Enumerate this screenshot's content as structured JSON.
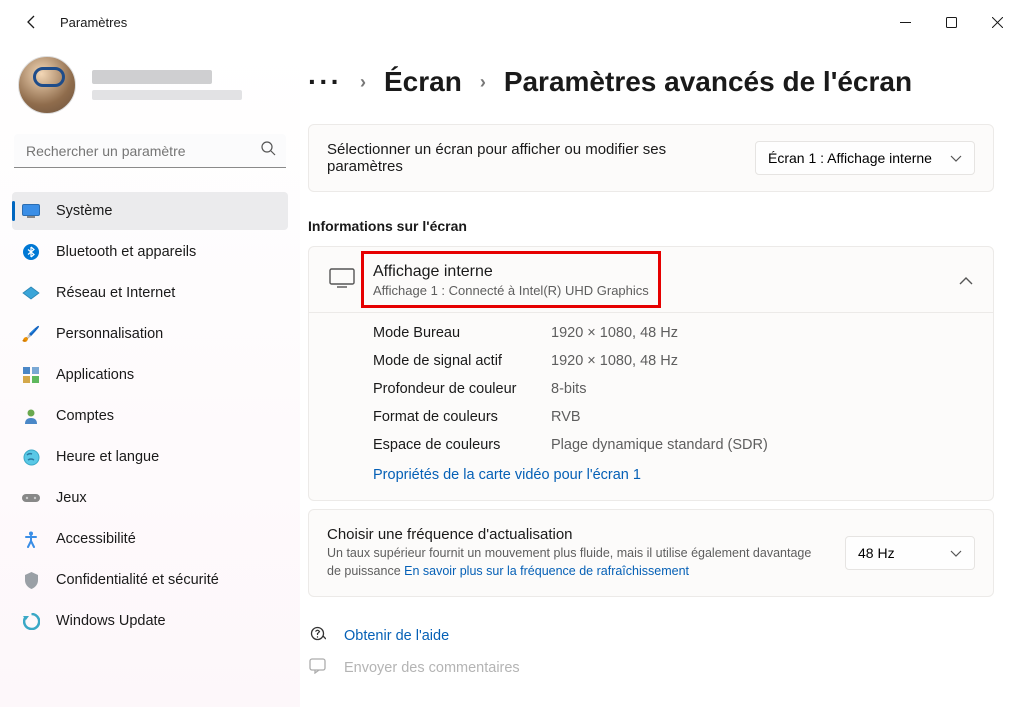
{
  "titlebar": {
    "app_title": "Paramètres"
  },
  "search": {
    "placeholder": "Rechercher un paramètre"
  },
  "sidebar": {
    "items": [
      {
        "label": "Système",
        "icon": "💻",
        "active": true
      },
      {
        "label": "Bluetooth et appareils",
        "icon": "bt"
      },
      {
        "label": "Réseau et Internet",
        "icon": "🔷"
      },
      {
        "label": "Personnalisation",
        "icon": "🖌️"
      },
      {
        "label": "Applications",
        "icon": "apps"
      },
      {
        "label": "Comptes",
        "icon": "👤"
      },
      {
        "label": "Heure et langue",
        "icon": "🌐"
      },
      {
        "label": "Jeux",
        "icon": "🎮"
      },
      {
        "label": "Accessibilité",
        "icon": "acc"
      },
      {
        "label": "Confidentialité et sécurité",
        "icon": "🛡️"
      },
      {
        "label": "Windows Update",
        "icon": "🔄"
      }
    ]
  },
  "breadcrumb": {
    "parent": "Écran",
    "current": "Paramètres avancés de l'écran"
  },
  "selector": {
    "label": "Sélectionner un écran pour afficher ou modifier ses paramètres",
    "value": "Écran 1 : Affichage interne"
  },
  "section": {
    "title": "Informations sur l'écran",
    "header_title": "Affichage interne",
    "header_sub": "Affichage 1 : Connecté à Intel(R) UHD Graphics",
    "rows": [
      {
        "key": "Mode Bureau",
        "val": "1920 × 1080, 48 Hz"
      },
      {
        "key": "Mode de signal actif",
        "val": "1920 × 1080, 48 Hz"
      },
      {
        "key": "Profondeur de couleur",
        "val": "8-bits"
      },
      {
        "key": "Format de couleurs",
        "val": "RVB"
      },
      {
        "key": "Espace de couleurs",
        "val": "Plage dynamique standard (SDR)"
      }
    ],
    "link": "Propriétés de la carte vidéo pour l'écran 1"
  },
  "refresh": {
    "title": "Choisir une fréquence d'actualisation",
    "desc": "Un taux supérieur fournit un mouvement plus fluide, mais il utilise également davantage de puissance  ",
    "link": "En savoir plus sur la fréquence de rafraîchissement",
    "value": "48 Hz"
  },
  "help": {
    "get_help": "Obtenir de l'aide",
    "feedback": "Envoyer des commentaires"
  }
}
